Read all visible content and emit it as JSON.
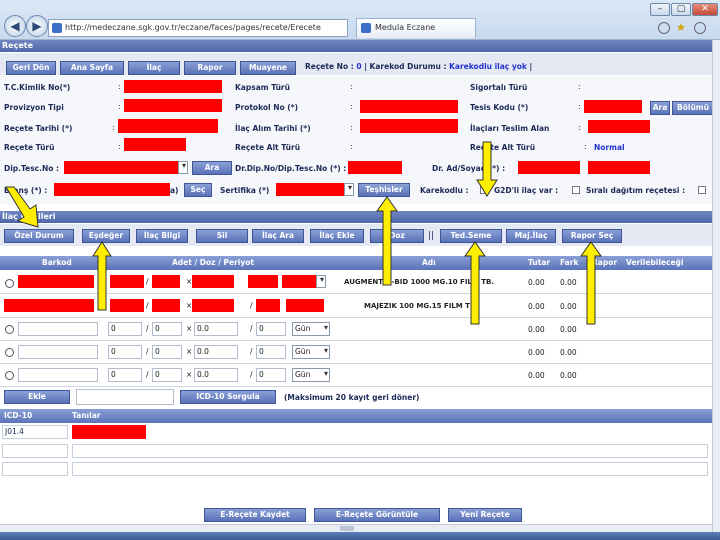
{
  "browser": {
    "url": "http://medeczane.sgk.gov.tr/eczane/faces/pages/recete/Erecete",
    "tab_title": "Medula Eczane",
    "back_icon": "back-arrow-icon",
    "forward_icon": "forward-arrow-icon"
  },
  "section_title": "Reçete",
  "top_buttons": [
    "Geri Dön",
    "Ana Sayfa",
    "İlaç",
    "Rapor",
    "Muayene"
  ],
  "recete_info": {
    "prefix": "Reçete No :",
    "no": "0",
    "separator": "| Karekod Durumu :",
    "status": "Karekodlu ilaç yok",
    "end": "|"
  },
  "form": {
    "tc_kimlik": "T.C.Kimlik No(*)",
    "kapsam_turu": "Kapsam Türü",
    "sigortali_turu": "Sigortalı Türü",
    "provizyon_tipi": "Provizyon Tipi",
    "protokol_no": "Protokol No (*)",
    "tesis_kodu": "Tesis Kodu (*)",
    "ara_button": "Ara",
    "bolumu_button": "Bölümü",
    "recete_tarihi": "Reçete Tarihi (*)",
    "ilac_alim_tarihi": "İlaç Alım Tarihi (*)",
    "ilaclari_teslim_alan": "İlaçları Teslim Alan",
    "recete_turu": "Reçete Türü",
    "recete_alt_turu": "Reçete Alt Türü",
    "recete_alt_turu_value": "Normal",
    "dip_tesc_no": "Dip.Tesc.No :",
    "ara_button2": "Ara",
    "dr_dip_no": "Dr.Dip.No/Dip.Tesc.No (*) :",
    "dr_ad_soyad": "Dr. Ad/Soyad (*) :",
    "brans": "Branş (*) :",
    "sec_button": "Seç",
    "sertifika": "Sertifika (*)",
    "teshisler_button": "Teşhisler",
    "karekodlu": "Karekodlu :",
    "g2d_ilac": "G2D'li ilaç var :",
    "sirali_dagitim": "Sıralı dağıtım reçetesi :"
  },
  "ilac_section_title": "İlaç Bilgileri",
  "ilac_buttons": [
    "Özel Durum",
    "Eşdeğer",
    "İlaç Bilgi",
    "Sil",
    "İlaç Ara",
    "İlaç Ekle",
    "Doz Aciklama",
    "Ted.Seme",
    "Maj.İlaç",
    "Rapor Seç"
  ],
  "grid_headers": [
    "Barkod",
    "Adet / Doz / Periyot",
    "Adı",
    "Tutar",
    "Fark",
    "Rapor",
    "Verilebileceği"
  ],
  "grid_rows": [
    {
      "name": "AUGMENTIN-BID 1000 MG.10 FILM TB.",
      "tutar": "0.00",
      "fark": "0.00"
    },
    {
      "name": "MAJEZIK 100 MG.15 FILM TB.",
      "tutar": "0.00",
      "fark": "0.00"
    },
    {
      "adet": "0",
      "doz": "0",
      "doz2": "0.0",
      "per": "0",
      "unit": "Gün",
      "tutar": "0.00",
      "fark": "0.00"
    },
    {
      "adet": "0",
      "doz": "0",
      "doz2": "0.0",
      "per": "0",
      "unit": "Gün",
      "tutar": "0.00",
      "fark": "0.00"
    },
    {
      "adet": "0",
      "doz": "0",
      "doz2": "0.0",
      "per": "0",
      "unit": "Gün",
      "tutar": "0.00",
      "fark": "0.00"
    }
  ],
  "ekle_button": "Ekle",
  "icd_button": "ICD-10 Sorgula",
  "icd_note": "(Maksimum 20 kayıt geri döner)",
  "icd_headers": [
    "ICD-10",
    "Tanılar"
  ],
  "icd_code": "J01.4",
  "bottom_buttons": [
    "E-Reçete Kaydet",
    "E-Reçete Görüntüle",
    "Yeni Reçete"
  ],
  "colors": {
    "accent": "#5a72b8",
    "title": "#4f67a8",
    "highlight_arrow": "#ffee00",
    "redaction": "#ff0000"
  }
}
